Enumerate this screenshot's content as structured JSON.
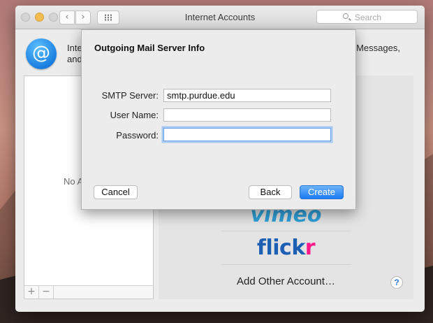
{
  "window": {
    "title": "Internet Accounts",
    "search_placeholder": "Search",
    "nav_back": "‹",
    "nav_forward": "›"
  },
  "description": {
    "line1_start": "Inte",
    "line1_end": "ar, Messages,",
    "line2_start": "and"
  },
  "accounts_list": {
    "empty_text": "No A",
    "add_button": "+",
    "remove_button": "−"
  },
  "providers": {
    "vimeo": "vimeo",
    "flickr_a": "flick",
    "flickr_b": "r",
    "add_other": "Add Other Account…",
    "help": "?"
  },
  "sheet": {
    "title": "Outgoing Mail Server Info",
    "smtp_label": "SMTP Server:",
    "smtp_value": "smtp.purdue.edu",
    "username_label": "User Name:",
    "username_value": "",
    "password_label": "Password:",
    "password_value": "",
    "cancel": "Cancel",
    "back": "Back",
    "create": "Create"
  },
  "colors": {
    "accent": "#1b7bf2",
    "vimeo": "#2fa1d9",
    "flickr_blue": "#1c5fb3",
    "flickr_pink": "#ff1a8c"
  }
}
